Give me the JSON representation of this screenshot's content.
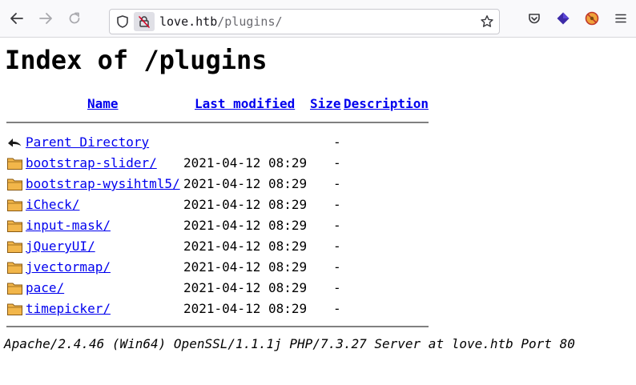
{
  "browser": {
    "url_host": "love.htb",
    "url_path": "/plugins/"
  },
  "page": {
    "title": "Index of /plugins",
    "columns": {
      "name": "Name",
      "last_modified": "Last modified",
      "size": "Size",
      "description": "Description"
    },
    "parent": {
      "name": "Parent Directory",
      "date": "",
      "size": "-"
    },
    "entries": [
      {
        "name": "bootstrap-slider/",
        "date": "2021-04-12 08:29",
        "size": "-"
      },
      {
        "name": "bootstrap-wysihtml5/",
        "date": "2021-04-12 08:29",
        "size": "-"
      },
      {
        "name": "iCheck/",
        "date": "2021-04-12 08:29",
        "size": "-"
      },
      {
        "name": "input-mask/",
        "date": "2021-04-12 08:29",
        "size": "-"
      },
      {
        "name": "jQueryUI/",
        "date": "2021-04-12 08:29",
        "size": "-"
      },
      {
        "name": "jvectormap/",
        "date": "2021-04-12 08:29",
        "size": "-"
      },
      {
        "name": "pace/",
        "date": "2021-04-12 08:29",
        "size": "-"
      },
      {
        "name": "timepicker/",
        "date": "2021-04-12 08:29",
        "size": "-"
      }
    ],
    "address": "Apache/2.4.46 (Win64) OpenSSL/1.1.1j PHP/7.3.27 Server at love.htb Port 80"
  },
  "icons": {
    "back": "back-arrow-icon",
    "forward": "forward-arrow-icon",
    "reload": "reload-icon",
    "shield": "tracking-shield-icon",
    "lock": "insecure-lock-icon",
    "star": "bookmark-star-icon",
    "pocket": "pocket-icon",
    "ext1": "extension-diamond-icon",
    "ext2": "extension-blocker-icon",
    "menu": "hamburger-menu-icon",
    "parent": "parent-directory-icon",
    "folder": "folder-icon"
  },
  "colors": {
    "link": "#0000ee",
    "rule": "#808080",
    "folder_fill": "#f2b64a",
    "folder_stroke": "#8a5a12"
  }
}
